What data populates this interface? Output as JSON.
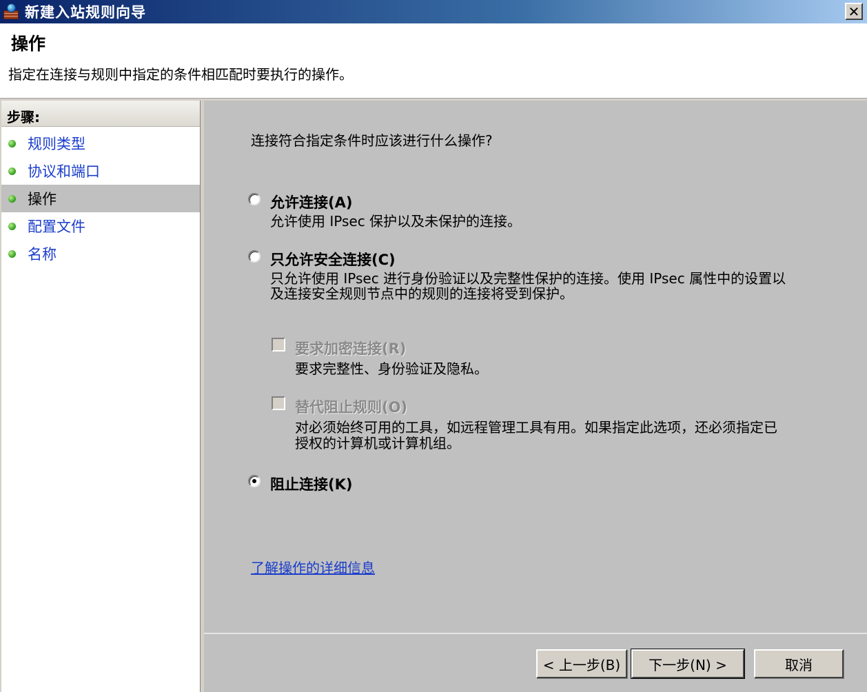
{
  "window": {
    "title": "新建入站规则向导",
    "close_label": "✕"
  },
  "header": {
    "title": "操作",
    "description": "指定在连接与规则中指定的条件相匹配时要执行的操作。"
  },
  "steps": {
    "heading": "步骤:",
    "items": [
      {
        "label": "规则类型",
        "active": false
      },
      {
        "label": "协议和端口",
        "active": false
      },
      {
        "label": "操作",
        "active": true
      },
      {
        "label": "配置文件",
        "active": false
      },
      {
        "label": "名称",
        "active": false
      }
    ]
  },
  "main": {
    "question": "连接符合指定条件时应该进行什么操作?",
    "options": {
      "allow": {
        "label": "允许连接(A)",
        "description": "允许使用 IPsec 保护以及未保护的连接。",
        "checked": false
      },
      "allow_secure": {
        "label": "只允许安全连接(C)",
        "description_line1": "只允许使用 IPsec 进行身份验证以及完整性保护的连接。使用 IPsec 属性中的设置以",
        "description_line2": "及连接安全规则节点中的规则的连接将受到保护。",
        "checked": false
      },
      "require_encryption": {
        "label": "要求加密连接(R)",
        "description": "要求完整性、身份验证及隐私。",
        "checked": false,
        "enabled": false
      },
      "override_block": {
        "label": "替代阻止规则(O)",
        "description_line1": "对必须始终可用的工具，如远程管理工具有用。如果指定此选项，还必须指定已",
        "description_line2": "授权的计算机或计算机组。",
        "checked": false,
        "enabled": false
      },
      "block": {
        "label": "阻止连接(K)",
        "checked": true
      }
    },
    "learn_more_link": "了解操作的详细信息"
  },
  "footer": {
    "back_label": "< 上一步(B)",
    "next_label": "下一步(N) >",
    "cancel_label": "取消"
  }
}
